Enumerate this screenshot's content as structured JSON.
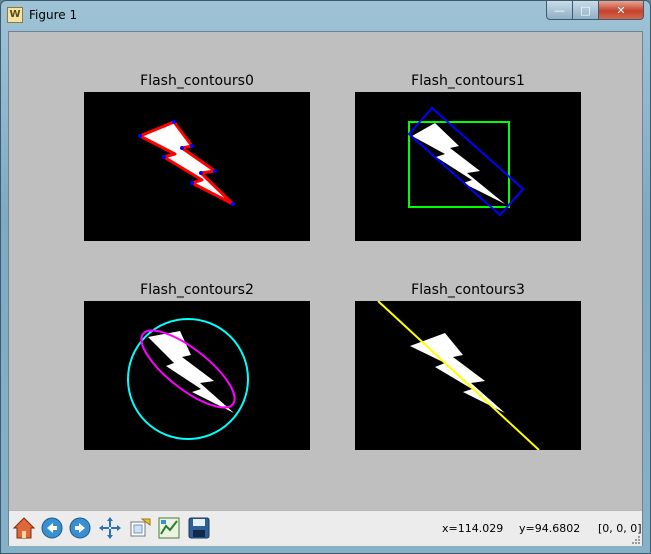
{
  "window": {
    "title": "Figure 1",
    "app_icon_glyph": "W",
    "min_glyph": "—",
    "max_glyph": "□",
    "close_glyph": "✕"
  },
  "subplots": [
    {
      "title": "Flash_contours0"
    },
    {
      "title": "Flash_contours1"
    },
    {
      "title": "Flash_contours2"
    },
    {
      "title": "Flash_contours3"
    }
  ],
  "colors": {
    "plot_background": "#000000",
    "shape_fill": "#ffffff",
    "contour": "#ff0000",
    "contour_points": "#0000ff",
    "bounding_rect": "#00ff00",
    "rotated_rect": "#0000ff",
    "enclosing_circle": "#00ffff",
    "fitted_ellipse": "#ff00ff",
    "fitted_line": "#ffff00"
  },
  "toolbar": {
    "buttons": [
      {
        "name": "home-icon"
      },
      {
        "name": "back-icon"
      },
      {
        "name": "forward-icon"
      },
      {
        "name": "pan-icon"
      },
      {
        "name": "zoom-icon"
      },
      {
        "name": "subplots-icon"
      },
      {
        "name": "save-icon"
      }
    ],
    "x_readout": "x=114.029",
    "y_readout": "y=94.6802",
    "pixel_value": "[0, 0, 0]"
  }
}
